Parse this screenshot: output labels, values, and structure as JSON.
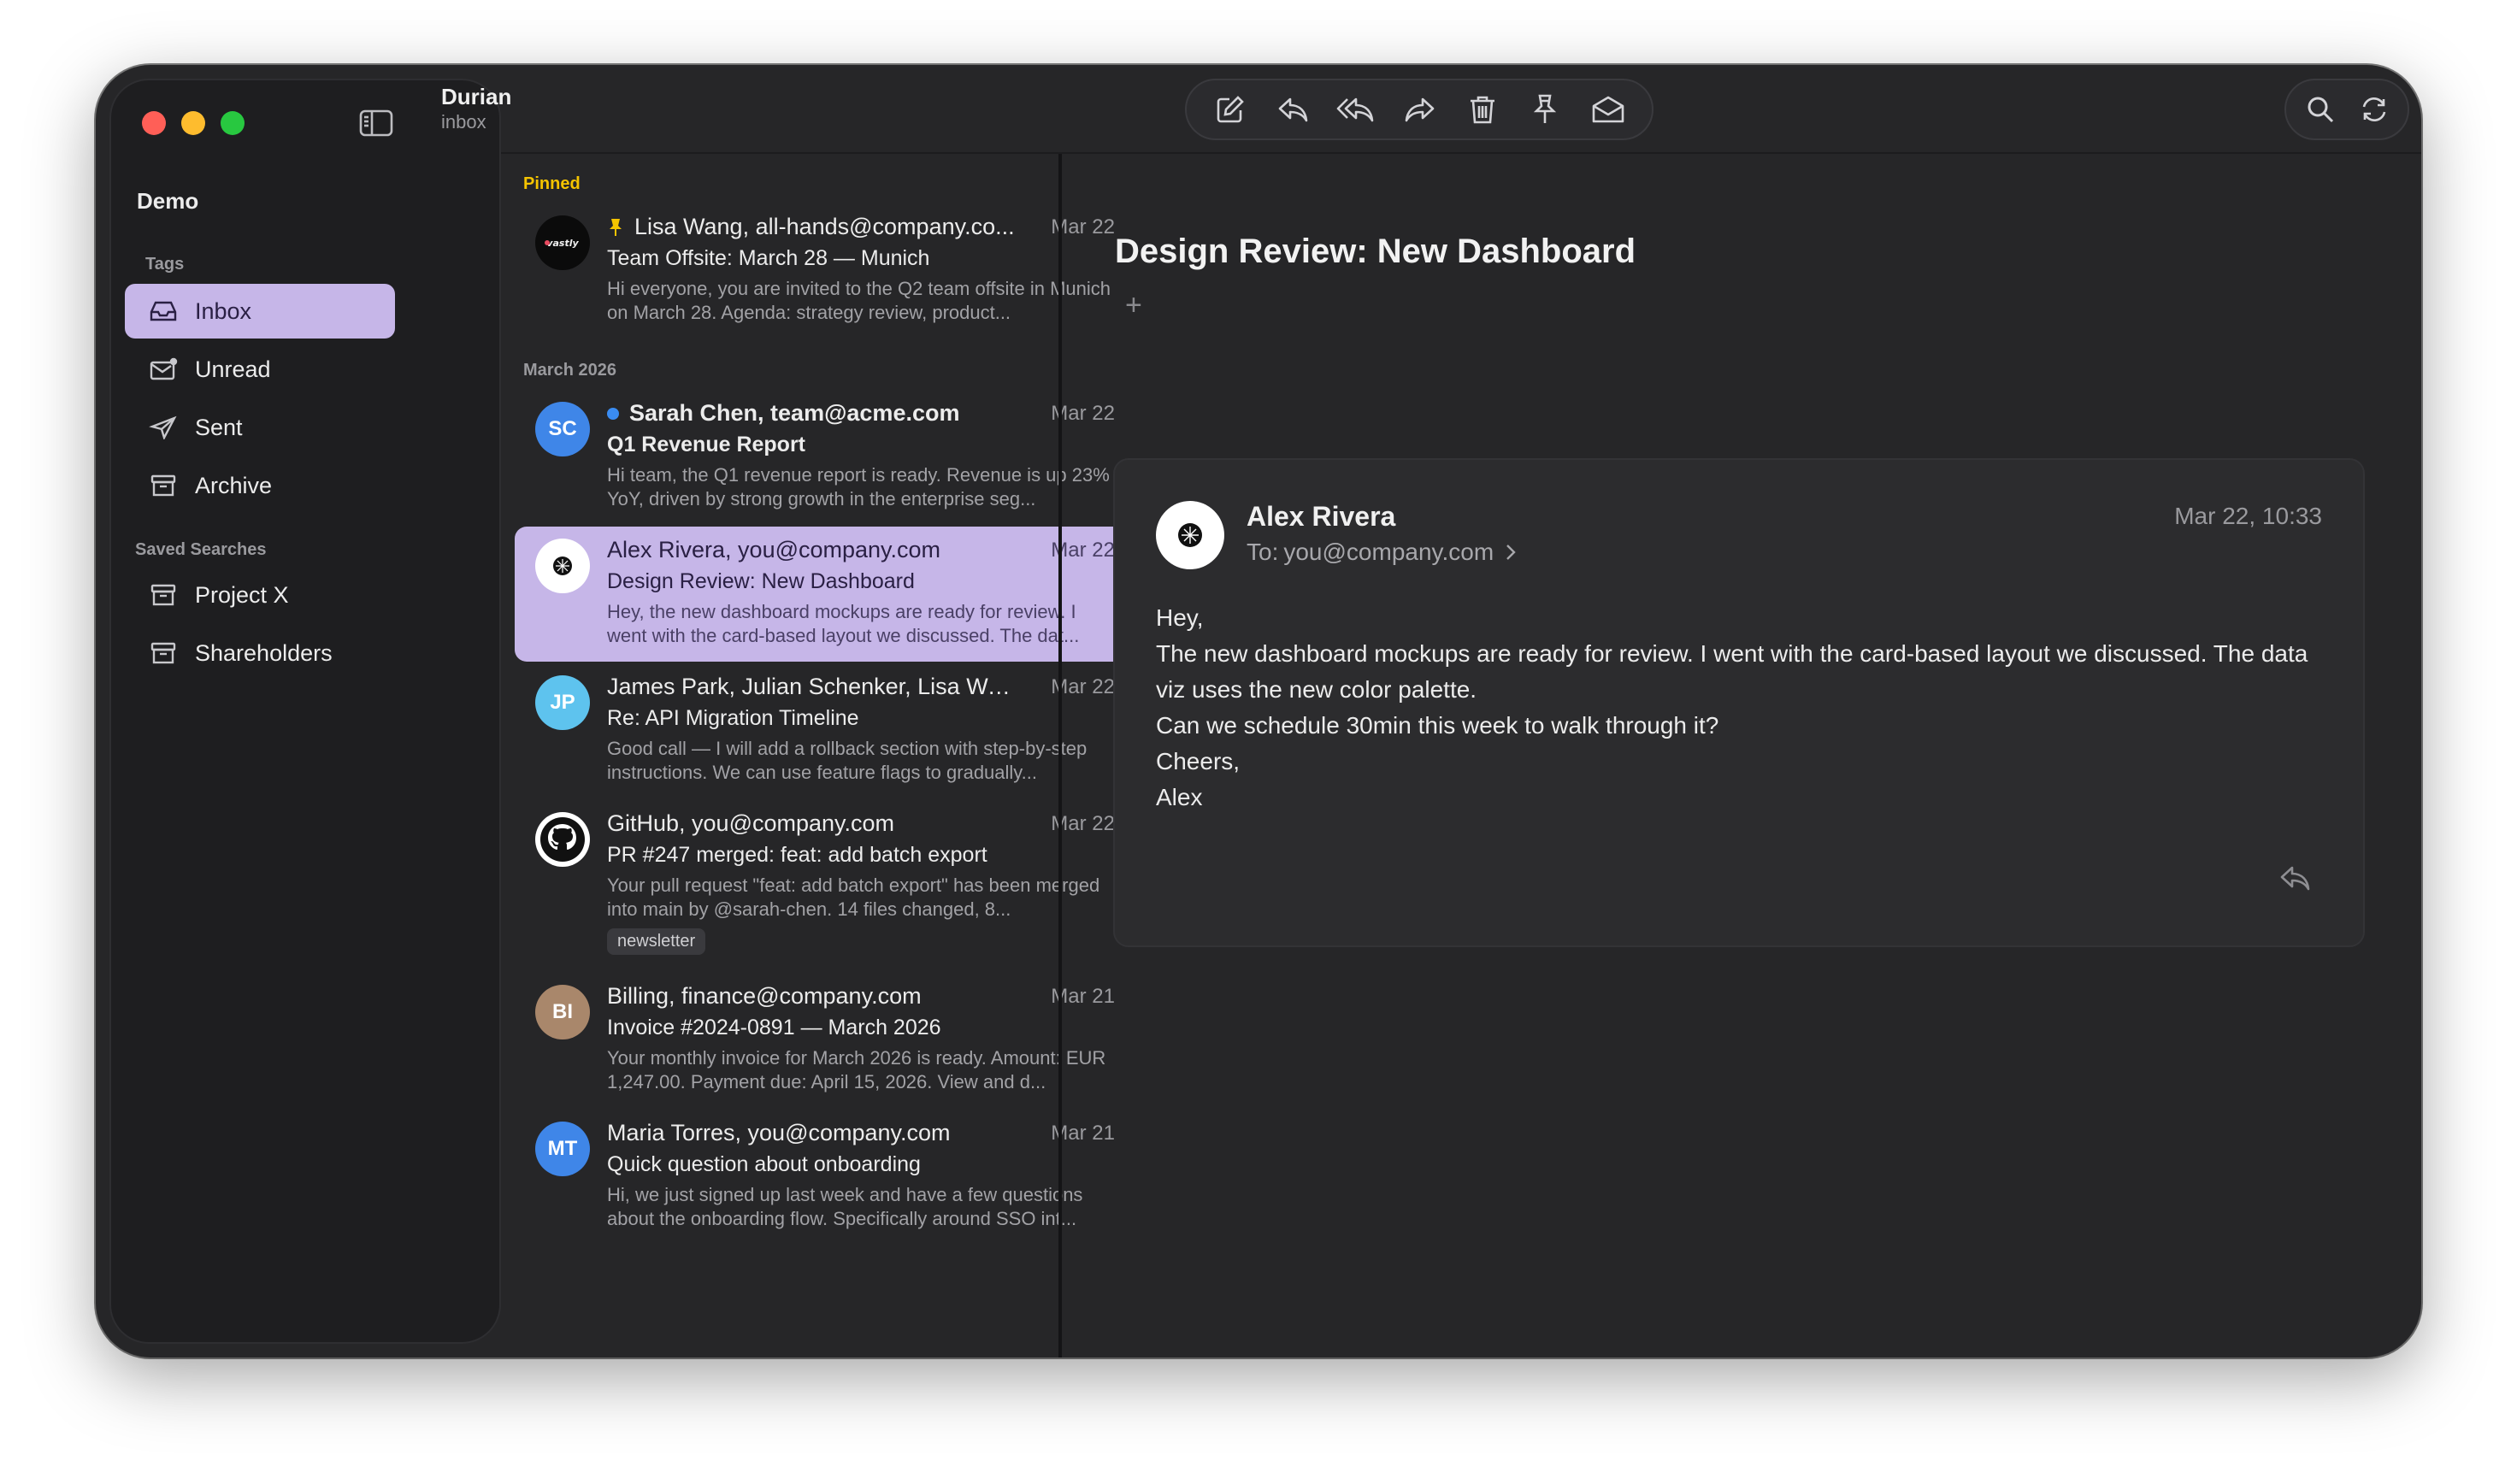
{
  "app": {
    "title": "Durian",
    "subtitle": "inbox"
  },
  "sidebar": {
    "account": "Demo",
    "tags_header": "Tags",
    "items": [
      {
        "label": "Inbox",
        "icon": "inbox-icon",
        "active": true
      },
      {
        "label": "Unread",
        "icon": "unread-icon"
      },
      {
        "label": "Sent",
        "icon": "sent-icon"
      },
      {
        "label": "Archive",
        "icon": "archive-icon"
      }
    ],
    "saved_header": "Saved Searches",
    "saved": [
      {
        "label": "Project X",
        "icon": "archive-icon"
      },
      {
        "label": "Shareholders",
        "icon": "archive-icon"
      }
    ]
  },
  "toolbar": {
    "buttons": [
      "compose-icon",
      "reply-icon",
      "reply-all-icon",
      "forward-icon",
      "trash-icon",
      "pin-icon",
      "mark-unread-icon"
    ],
    "right": [
      "search-icon",
      "refresh-icon"
    ]
  },
  "list": {
    "pinned_header": "Pinned",
    "month_header": "March 2026",
    "messages": [
      {
        "from": "Lisa Wang, all-hands@company.co...",
        "date": "Mar 22",
        "subject": "Team Offsite: March 28 — Munich",
        "preview": "Hi everyone, you are invited to the Q2 team offsite in Munich on March 28. Agenda: strategy review, product...",
        "avatar": "vastly",
        "pinned": true
      },
      {
        "from": "Sarah Chen, team@acme.com",
        "date": "Mar 22",
        "subject": "Q1 Revenue Report",
        "preview": "Hi team, the Q1 revenue report is ready. Revenue is up 23% YoY, driven by strong growth in the enterprise seg...",
        "avatar": "SC",
        "avatar_color": "#3f86e8",
        "unread": true
      },
      {
        "from": "Alex Rivera, you@company.com",
        "date": "Mar 22",
        "subject": "Design Review: New Dashboard",
        "preview": "Hey, the new dashboard mockups are ready for review. I went with the card-based layout we discussed. The dat...",
        "selected": true
      },
      {
        "from": "James Park, Julian Schenker, Lisa Wa...",
        "date": "Mar 22",
        "subject": "Re: API Migration Timeline",
        "preview": "Good call — I will add a rollback section with step-by-step instructions. We can use feature flags to gradually...",
        "avatar": "JP",
        "avatar_color": "#5ec3ee"
      },
      {
        "from": "GitHub, you@company.com",
        "date": "Mar 22",
        "subject": "PR #247 merged: feat: add batch export",
        "preview": "Your pull request \"feat: add batch export\" has been merged into main by @sarah-chen. 14 files changed, 8...",
        "tag": "newsletter"
      },
      {
        "from": "Billing, finance@company.com",
        "date": "Mar 21",
        "subject": "Invoice #2024-0891 — March 2026",
        "preview": "Your monthly invoice for March 2026 is ready. Amount: EUR 1,247.00. Payment due: April 15, 2026. View and d...",
        "avatar": "BI",
        "avatar_color": "#a9876b"
      },
      {
        "from": "Maria Torres, you@company.com",
        "date": "Mar 21",
        "subject": "Quick question about onboarding",
        "preview": "Hi, we just signed up last week and have a few questions about the onboarding flow. Specifically around SSO int...",
        "avatar": "MT",
        "avatar_color": "#3f86e8"
      }
    ]
  },
  "reader": {
    "title": "Design Review: New Dashboard",
    "add_tag": "+",
    "sender": "Alex Rivera",
    "to_label": "To:",
    "to": "you@company.com",
    "time": "Mar 22, 10:33",
    "body": [
      "Hey,",
      "The new dashboard mockups are ready for review. I went with the card-based layout we discussed. The data viz uses the new color palette.",
      "Can we schedule 30min this week to walk through it?",
      "Cheers,",
      "Alex"
    ]
  },
  "colors": {
    "accent": "#c6b6e8",
    "unread_dot": "#3a8cf2",
    "pinned_header": "#f5c400"
  }
}
